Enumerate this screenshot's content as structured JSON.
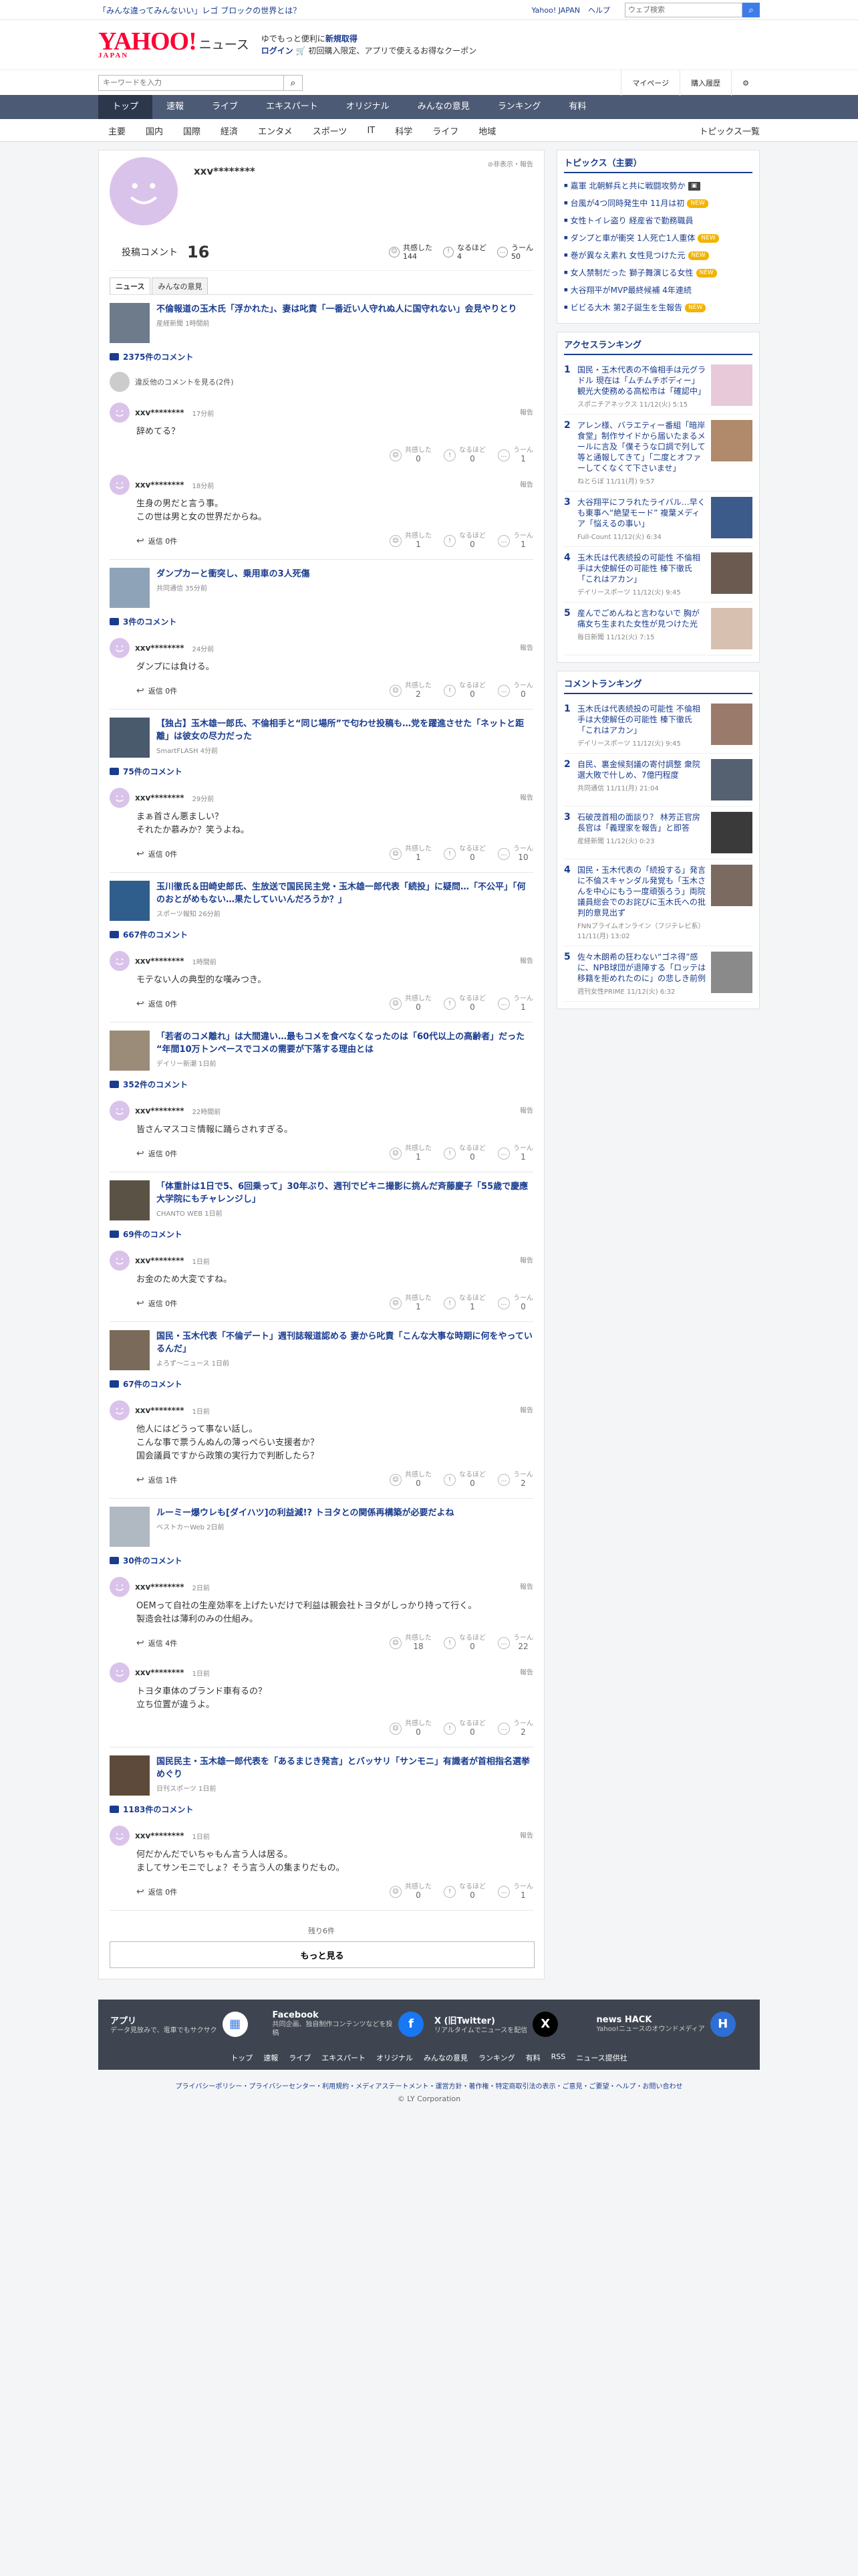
{
  "top": {
    "promo": "「みんな違ってみんないい」レゴ ブロックの世界とは？",
    "links": [
      "Yahoo! JAPAN",
      "ヘルプ"
    ],
    "search_placeholder": "ウェブ検索"
  },
  "brand": {
    "logo": "YAHOO!",
    "logo_sub": "JAPAN",
    "news": "ニュース",
    "promo1": "ゆでもっと便利に",
    "promo1b": "新規取得",
    "promo2a": "ログイン",
    "promo2b": "初回購入限定、アプリで使えるお得なクーポン"
  },
  "search": {
    "placeholder": "キーワードを入力",
    "mypage": "マイページ",
    "history": "購入履歴"
  },
  "nav": [
    "トップ",
    "速報",
    "ライブ",
    "エキスパート",
    "オリジナル",
    "みんなの意見",
    "ランキング",
    "有料"
  ],
  "subnav": [
    "主要",
    "国内",
    "国際",
    "経済",
    "エンタメ",
    "スポーツ",
    "IT",
    "科学",
    "ライフ",
    "地域"
  ],
  "subnav_right": "トピックス一覧",
  "profile": {
    "name": "xxv********",
    "hide": "非表示・報告",
    "posts_label": "投稿コメント",
    "posts": "16",
    "rx": [
      {
        "label": "共感した",
        "value": "144"
      },
      {
        "label": "なるほど",
        "value": "4"
      },
      {
        "label": "うーん",
        "value": "50"
      }
    ],
    "tabs": [
      "ニュース",
      "みんなの意見"
    ]
  },
  "labels": {
    "replies_suffix": "件",
    "report": "報告",
    "empathy": "共感した",
    "naruhodo": "なるほど",
    "hmm": "うーん",
    "reply": "返信"
  },
  "articles": [
    {
      "title": "不倫報道の玉木氏「浮かれた」、妻は叱責「一番近い人守れぬ人に国守れない」会見やりとり",
      "src": "産経新聞 1時間前",
      "count": "2375件のコメント",
      "hidden": "違反他のコメントを見る(2件)",
      "comments": [
        {
          "name": "xxv********",
          "time": "17分前",
          "text": "辞めてる？",
          "replies": "",
          "r": [
            "0",
            "0",
            "1"
          ]
        },
        {
          "name": "xxv********",
          "time": "18分前",
          "text": "生身の男だと言う事。\nこの世は男と女の世界だからね。",
          "replies": "返信 0件",
          "r": [
            "1",
            "0",
            "1"
          ]
        }
      ]
    },
    {
      "title": "ダンプカーと衝突し、乗用車の3人死傷",
      "src": "共同通信 35分前",
      "count": "3件のコメント",
      "comments": [
        {
          "name": "xxv********",
          "time": "24分前",
          "text": "ダンプには負ける。",
          "replies": "返信 0件",
          "r": [
            "2",
            "0",
            "0"
          ]
        }
      ]
    },
    {
      "title": "【独占】玉木雄一郎氏、不倫相手と“同じ場所”で匂わせ投稿も…党を躍進させた「ネットと距離」は彼女の尽力だった",
      "src": "SmartFLASH 4分前",
      "count": "75件のコメント",
      "comments": [
        {
          "name": "xxv********",
          "time": "29分前",
          "text": "まぁ首さん悪ましい？\nそれたか慕みか？笑うよね。",
          "replies": "返信 0件",
          "r": [
            "1",
            "0",
            "10"
          ]
        }
      ]
    },
    {
      "title": "玉川徹氏＆田崎史郎氏、生放送で国民民主党・玉木雄一郎代表「続投」に疑問…「不公平」「何のおとがめもない…果たしていいんだろうか？」",
      "src": "スポーツ報知 26分前",
      "count": "667件のコメント",
      "comments": [
        {
          "name": "xxv********",
          "time": "1時間前",
          "text": "モテない人の典型的な嘆みつき。",
          "replies": "返信 0件",
          "r": [
            "0",
            "0",
            "1"
          ]
        }
      ]
    },
    {
      "title": "「若者のコメ離れ」は大間違い…最もコメを食べなくなったのは「60代以上の高齢者」だった “年間10万トンペースでコメの需要が下落する理由とは",
      "src": "デイリー新潮 1日前",
      "count": "352件のコメント",
      "comments": [
        {
          "name": "xxv********",
          "time": "22時間前",
          "text": "皆さんマスコミ情報に踊らされすぎる。",
          "replies": "返信 0件",
          "r": [
            "1",
            "0",
            "1"
          ]
        }
      ]
    },
    {
      "title": "「体重計は1日で5、6回乗って」30年ぶり、週刊でビキニ撮影に挑んだ斉藤慶子「55歳で慶應大学院にもチャレンジし」",
      "src": "CHANTO WEB 1日前",
      "count": "69件のコメント",
      "comments": [
        {
          "name": "xxv********",
          "time": "1日前",
          "text": "お金のため大変ですね。",
          "replies": "返信 0件",
          "r": [
            "1",
            "1",
            "0"
          ]
        }
      ]
    },
    {
      "title": "国民・玉木代表「不倫デート」週刊誌報道認める 妻から叱責「こんな大事な時期に何をやっているんだ」",
      "src": "よろず〜ニュース 1日前",
      "count": "67件のコメント",
      "comments": [
        {
          "name": "xxv********",
          "time": "1日前",
          "text": "他人にはどうって事ない話し。\nこんな事で票うんぬんの薄っぺらい支援者か？\n国会議員ですから政策の実行力で判断したら？",
          "replies": "返信 1件",
          "r": [
            "0",
            "0",
            "2"
          ]
        }
      ]
    },
    {
      "title": "ルーミー爆ウレも[ダイハツ]の利益減!? トヨタとの関係再構築が必要だよね",
      "src": "ベストカーWeb 2日前",
      "count": "30件のコメント",
      "comments": [
        {
          "name": "xxv********",
          "time": "2日前",
          "text": "OEMって自社の生産効率を上げたいだけで利益は親会社トヨタがしっかり持って行く。\n製造会社は薄利のみの仕組み。",
          "replies": "返信 4件",
          "r": [
            "18",
            "0",
            "22"
          ]
        },
        {
          "name": "xxv********",
          "time": "1日前",
          "text": "トヨタ車体のブランド車有るの？\n立ち位置が違うよ。",
          "replies": "",
          "r": [
            "0",
            "0",
            "2"
          ]
        }
      ]
    },
    {
      "title": "国民民主・玉木雄一郎代表を「あるまじき発言」とバッサリ「サンモニ」有識者が首相指名選挙めぐり",
      "src": "日刊スポーツ 1日前",
      "count": "1183件のコメント",
      "comments": [
        {
          "name": "xxv********",
          "time": "1日前",
          "text": "何だかんだでいちゃもん言う人は居る。\nましてサンモニでしょ？そう言う人の集まりだもの。",
          "replies": "返信 0件",
          "r": [
            "0",
            "0",
            "1"
          ]
        }
      ]
    }
  ],
  "remain": "残り6件",
  "more": "もっと見る",
  "side": {
    "topics_title": "トピックス（主要）",
    "topics": [
      {
        "t": "嘉軍 北朝鮮兵と共に戦闘攻勢か",
        "b": "img"
      },
      {
        "t": "台風が4つ同時発生中 11月は初",
        "b": "NEW"
      },
      {
        "t": "女性トイレ盗り 経産省で勤務職員",
        "b": ""
      },
      {
        "t": "ダンプと車が衝突 1人死亡1人重体",
        "b": "NEW"
      },
      {
        "t": "巻が異なえ素れ 女性見つけた元",
        "b": "NEW"
      },
      {
        "t": "女人禁制だった 獅子舞演じる女性",
        "b": "NEW"
      },
      {
        "t": "大谷翔平がMVP最終候補 4年連続",
        "b": ""
      },
      {
        "t": "ビビる大木 第2子誕生を生報告",
        "b": "NEW"
      }
    ],
    "access_title": "アクセスランキング",
    "access": [
      {
        "n": "1",
        "t": "国民・玉木代表の不倫相手は元グラドル 現在は「ムチムチボディー」観光大使務める高松市は「確認中」",
        "s": "スポニチアネックス 11/12(火) 5:15"
      },
      {
        "n": "2",
        "t": "アレン様、バラエティー番組「暗岸食堂」制作サイドから届いたまるメールに言及「僕そうな口調で列して等と通報してきて」「二度とオファーしてくなくて下さいませ」",
        "s": "ねとらぼ 11/11(月) 9:57"
      },
      {
        "n": "3",
        "t": "大谷翔平にフラれたライバル…早くも東事へ“絶望モード” 複葉メディア「悩えるの事い」",
        "s": "Full-Count 11/12(火) 6:34"
      },
      {
        "n": "4",
        "t": "玉木氏は代表続投の可能性 不倫相手は大使解任の可能性 榛下徹氏「これはアカン」",
        "s": "デイリースポーツ 11/12(火) 9:45"
      },
      {
        "n": "5",
        "t": "産んでごめんねと言わないで 胸が痛女ち生まれた女性が見つけた光",
        "s": "毎日新聞 11/12(火) 7:15"
      }
    ],
    "comment_title": "コメントランキング",
    "comment": [
      {
        "n": "1",
        "t": "玉木氏は代表続投の可能性 不倫相手は大使解任の可能性 榛下徹氏「これはアカン」",
        "s": "デイリースポーツ 11/12(火) 9:45"
      },
      {
        "n": "2",
        "t": "自民、裏金候刻議の寄付調整 衆院選大敗で什しめ、7億円程度",
        "s": "共同通信 11/11(月) 21:04"
      },
      {
        "n": "3",
        "t": "石破茂首相の面談り？ 林芳正官房長官は「義理家を報告」と即答",
        "s": "産経新聞 11/12(火) 0:23"
      },
      {
        "n": "4",
        "t": "国民・玉木代表の「続投する」発言に不倫スキャンダル発覚も「玉木さんを中心にもう一度頑張ろう」両院議員総会でのお詫びに玉木氏への批判的意見出ず",
        "s": "FNNプライムオンライン（フジテレビ系） 11/11(月) 13:02"
      },
      {
        "n": "5",
        "t": "佐々木朗希の狂わない“ゴネ得”感に、NPB球団が退陣する「ロッテは移籍を拒めれたのに」の悲しき前例",
        "s": "週刊女性PRIME 11/12(火) 6:32"
      }
    ]
  },
  "footer": {
    "cols": [
      {
        "t": "アプリ",
        "d": "データ見放みで、電車でもサクサク",
        "icon": "app-icon"
      },
      {
        "t": "Facebook",
        "d": "共同企画、独自制作コンテンツなどを投稿",
        "icon": "facebook-icon"
      },
      {
        "t": "X (旧Twitter)",
        "d": "リアルタイムでニュースを配信",
        "icon": "x-icon"
      },
      {
        "t": "news HACK",
        "d": "Yahoo!ニュースのオウンドメディア",
        "icon": "newshack-icon"
      }
    ],
    "links": [
      "トップ",
      "速報",
      "ライブ",
      "エキスパート",
      "オリジナル",
      "みんなの意見",
      "ランキング",
      "有料",
      "RSS",
      "ニュース提供社"
    ],
    "bottom": "プライバシーポリシー・プライバシーセンター・利用規約・メディアステートメント・運営方針・著作権・特定商取引法の表示・ご意見・ご要望・ヘルプ・お問い合わせ",
    "copy": "© LY Corporation"
  }
}
